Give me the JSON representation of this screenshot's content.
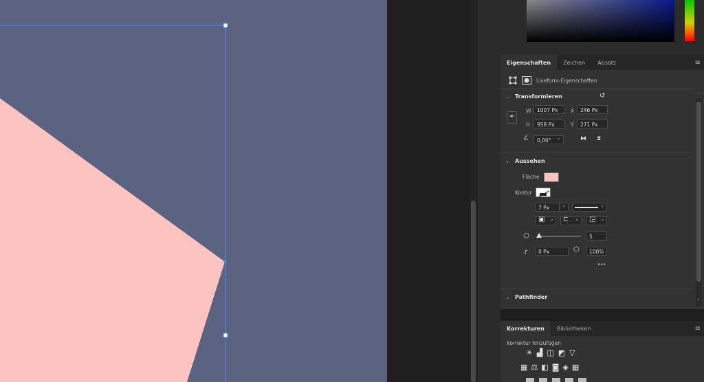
{
  "colors": {
    "canvas": "#5a6381",
    "shape_fill": "#fdc4bf",
    "selection": "#4a8cff"
  },
  "tabs": [
    {
      "label": "Eigenschaften",
      "active": true
    },
    {
      "label": "Zeichen",
      "active": false
    },
    {
      "label": "Absatz",
      "active": false
    }
  ],
  "props": {
    "live_shape_label": "Liveform-Eigenschaften",
    "transform": {
      "title": "Transformieren",
      "w_label": "W",
      "w_value": "1007 Px",
      "h_label": "H",
      "h_value": "958 Px",
      "x_label": "X",
      "x_value": "246 Px",
      "y_label": "Y",
      "y_value": "271 Px",
      "angle_value": "0,00°"
    },
    "appearance": {
      "title": "Aussehen",
      "fill_label": "Fläche",
      "stroke_label": "Kontur",
      "stroke_width": "7 Px",
      "sides_value": "5",
      "corner_radius": "0 Px",
      "star_ratio": "100%",
      "more": "•••"
    },
    "pathfinder_title": "Pathfinder"
  },
  "korrekturen": {
    "tabs": [
      {
        "label": "Korrekturen",
        "active": true
      },
      {
        "label": "Bibliotheken",
        "active": false
      }
    ],
    "add_label": "Korrektur hinzufügen",
    "icons_row1": [
      "☀",
      "▟",
      "◫",
      "◩",
      "▽"
    ],
    "icons_row2": [
      "▦",
      "⚖",
      "◧",
      "◙",
      "◈",
      "▦"
    ]
  }
}
